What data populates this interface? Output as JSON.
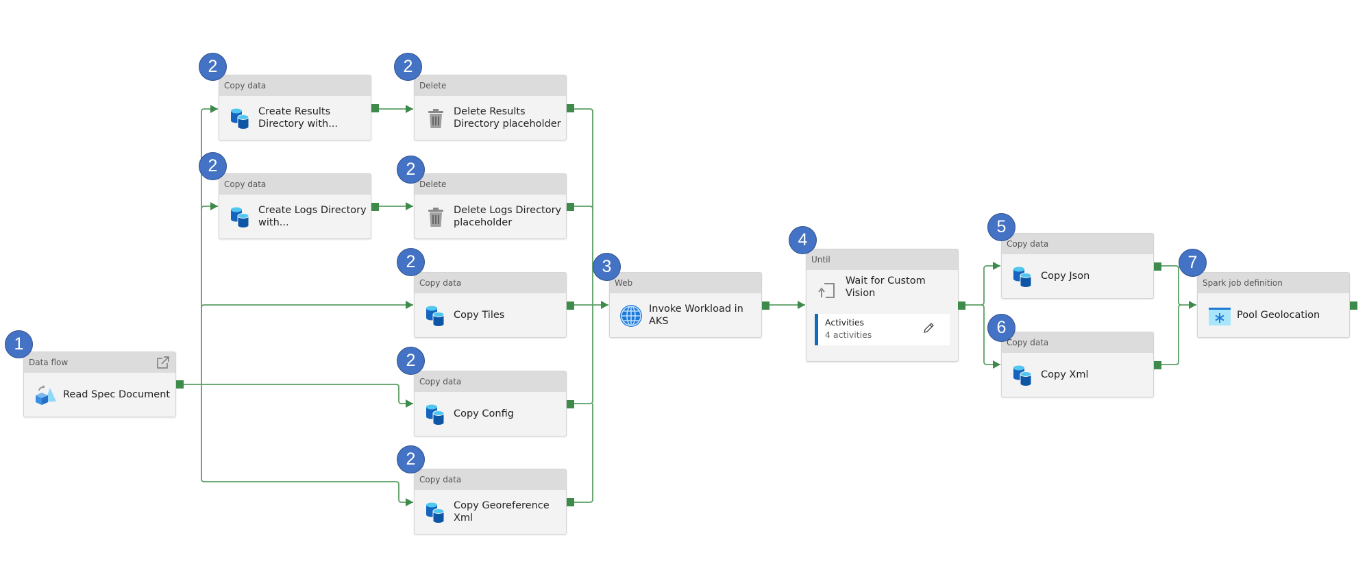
{
  "pipeline": {
    "activities": [
      {
        "id": "read-spec",
        "type": "Data flow",
        "name": "Read Spec Document",
        "step": "1",
        "icon": "data-flow-icon"
      },
      {
        "id": "create-results",
        "type": "Copy data",
        "name": "Create Results Directory with...",
        "step": "2",
        "icon": "copy-data-icon"
      },
      {
        "id": "create-logs",
        "type": "Copy data",
        "name": "Create Logs Directory with...",
        "step": "2",
        "icon": "copy-data-icon"
      },
      {
        "id": "delete-results",
        "type": "Delete",
        "name": "Delete Results Directory placeholder",
        "step": "2",
        "icon": "trash-icon"
      },
      {
        "id": "delete-logs",
        "type": "Delete",
        "name": "Delete Logs Directory placeholder",
        "step": "2",
        "icon": "trash-icon"
      },
      {
        "id": "copy-tiles",
        "type": "Copy data",
        "name": "Copy Tiles",
        "step": "2",
        "icon": "copy-data-icon"
      },
      {
        "id": "copy-config",
        "type": "Copy data",
        "name": "Copy Config",
        "step": "2",
        "icon": "copy-data-icon"
      },
      {
        "id": "copy-georef",
        "type": "Copy data",
        "name": "Copy Georeference Xml",
        "step": "2",
        "icon": "copy-data-icon"
      },
      {
        "id": "invoke-aks",
        "type": "Web",
        "name": "Invoke Workload in AKS",
        "step": "3",
        "icon": "globe-icon"
      },
      {
        "id": "wait-cv",
        "type": "Until",
        "name": "Wait for Custom Vision",
        "step": "4",
        "icon": "until-loop-icon",
        "activities_label": "Activities",
        "activities_count": "4 activities"
      },
      {
        "id": "copy-json",
        "type": "Copy data",
        "name": "Copy Json",
        "step": "5",
        "icon": "copy-data-icon"
      },
      {
        "id": "copy-xml",
        "type": "Copy data",
        "name": "Copy Xml",
        "step": "6",
        "icon": "copy-data-icon"
      },
      {
        "id": "pool-geo",
        "type": "Spark job definition",
        "name": "Pool Geolocation",
        "step": "7",
        "icon": "spark-job-icon"
      }
    ],
    "colors": {
      "link": "#5a9e63",
      "port": "#3e8a4a",
      "badge": "#4472c4",
      "activities_bar": "#0f6cbd"
    }
  }
}
